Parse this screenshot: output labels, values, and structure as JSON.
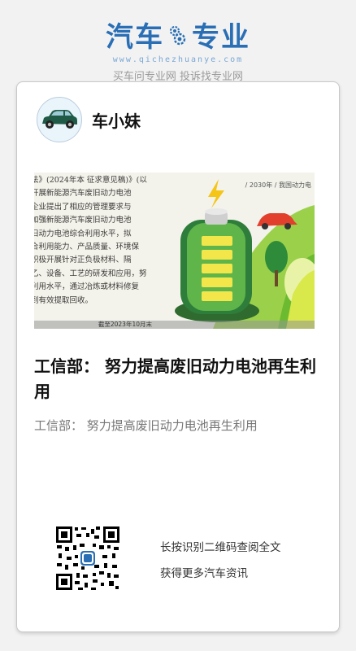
{
  "brand": {
    "title_left": "汽车",
    "title_right": "专业",
    "url": "www.qichezhuanye.com",
    "slogan": "买车问专业网 投诉找专业网",
    "color": "#2a6fb5"
  },
  "card": {
    "author": {
      "name": "车小妹",
      "avatar_icon": "car-icon"
    },
    "hero": {
      "text_lines": [
        "法》(2024年本 征求意见稿)》(以",
        "开展新能源汽车废旧动力电池",
        "企业提出了相应的管理要求与",
        "加强新能源汽车废旧动力电池",
        "旧动力电池综合利用水平，拟",
        "合利用能力、产品质量、环境保",
        "积极开展针对正负极材料、隔",
        "乙、设备、工艺的研发和应用，努",
        "利用水平，通过冶炼或材料修复",
        "到有效提取回收。"
      ],
      "year_label": "/ 2030年 / 我国动力电",
      "caption": "截至2023年10月末"
    },
    "headline": "工信部：  努力提高废旧动力电池再生利用",
    "summary": "工信部：  努力提高废旧动力电池再生利用",
    "qr_hint": [
      "长按识别二维码查阅全文",
      "获得更多汽车资讯"
    ]
  }
}
